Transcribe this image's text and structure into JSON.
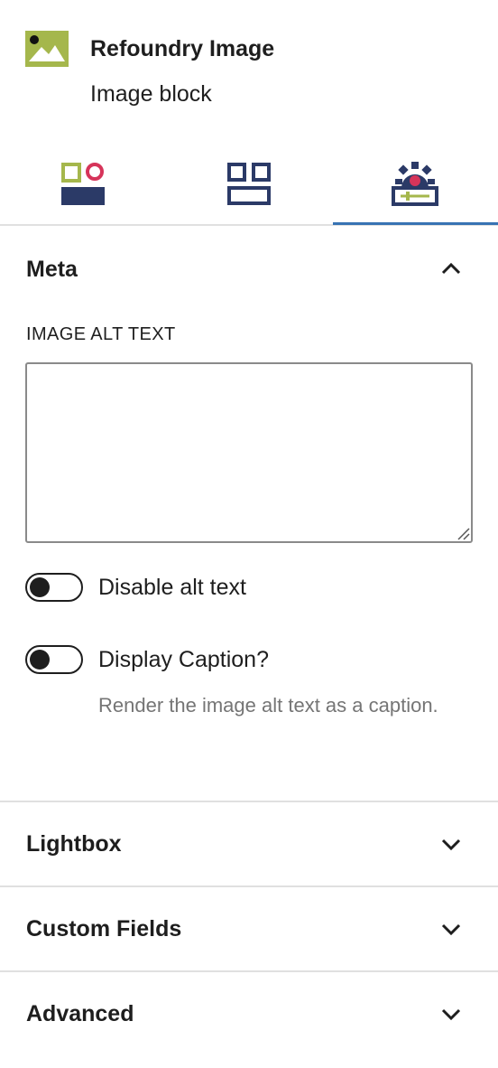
{
  "block": {
    "title": "Refoundry Image",
    "description": "Image block",
    "icon": "image-block-icon",
    "icon_color": "#a5b74c"
  },
  "tabs": [
    {
      "name": "styles-tab",
      "icon": "styles-shapes-icon"
    },
    {
      "name": "layout-tab",
      "icon": "layout-grid-icon"
    },
    {
      "name": "settings-tab",
      "icon": "settings-gear-icon",
      "active": true
    }
  ],
  "colors": {
    "navy": "#2b3a67",
    "olive": "#a5b74c",
    "pink": "#d6345a",
    "active_tab": "#3873b3"
  },
  "meta_panel": {
    "title": "Meta",
    "expanded": true,
    "alt_text": {
      "label": "IMAGE ALT TEXT",
      "value": ""
    },
    "disable_alt_text": {
      "label": "Disable alt text",
      "checked": false
    },
    "display_caption": {
      "label": "Display Caption?",
      "checked": false,
      "help": "Render the image alt text as a caption."
    }
  },
  "panels": [
    {
      "title": "Lightbox",
      "expanded": false
    },
    {
      "title": "Custom Fields",
      "expanded": false
    },
    {
      "title": "Advanced",
      "expanded": false
    }
  ]
}
